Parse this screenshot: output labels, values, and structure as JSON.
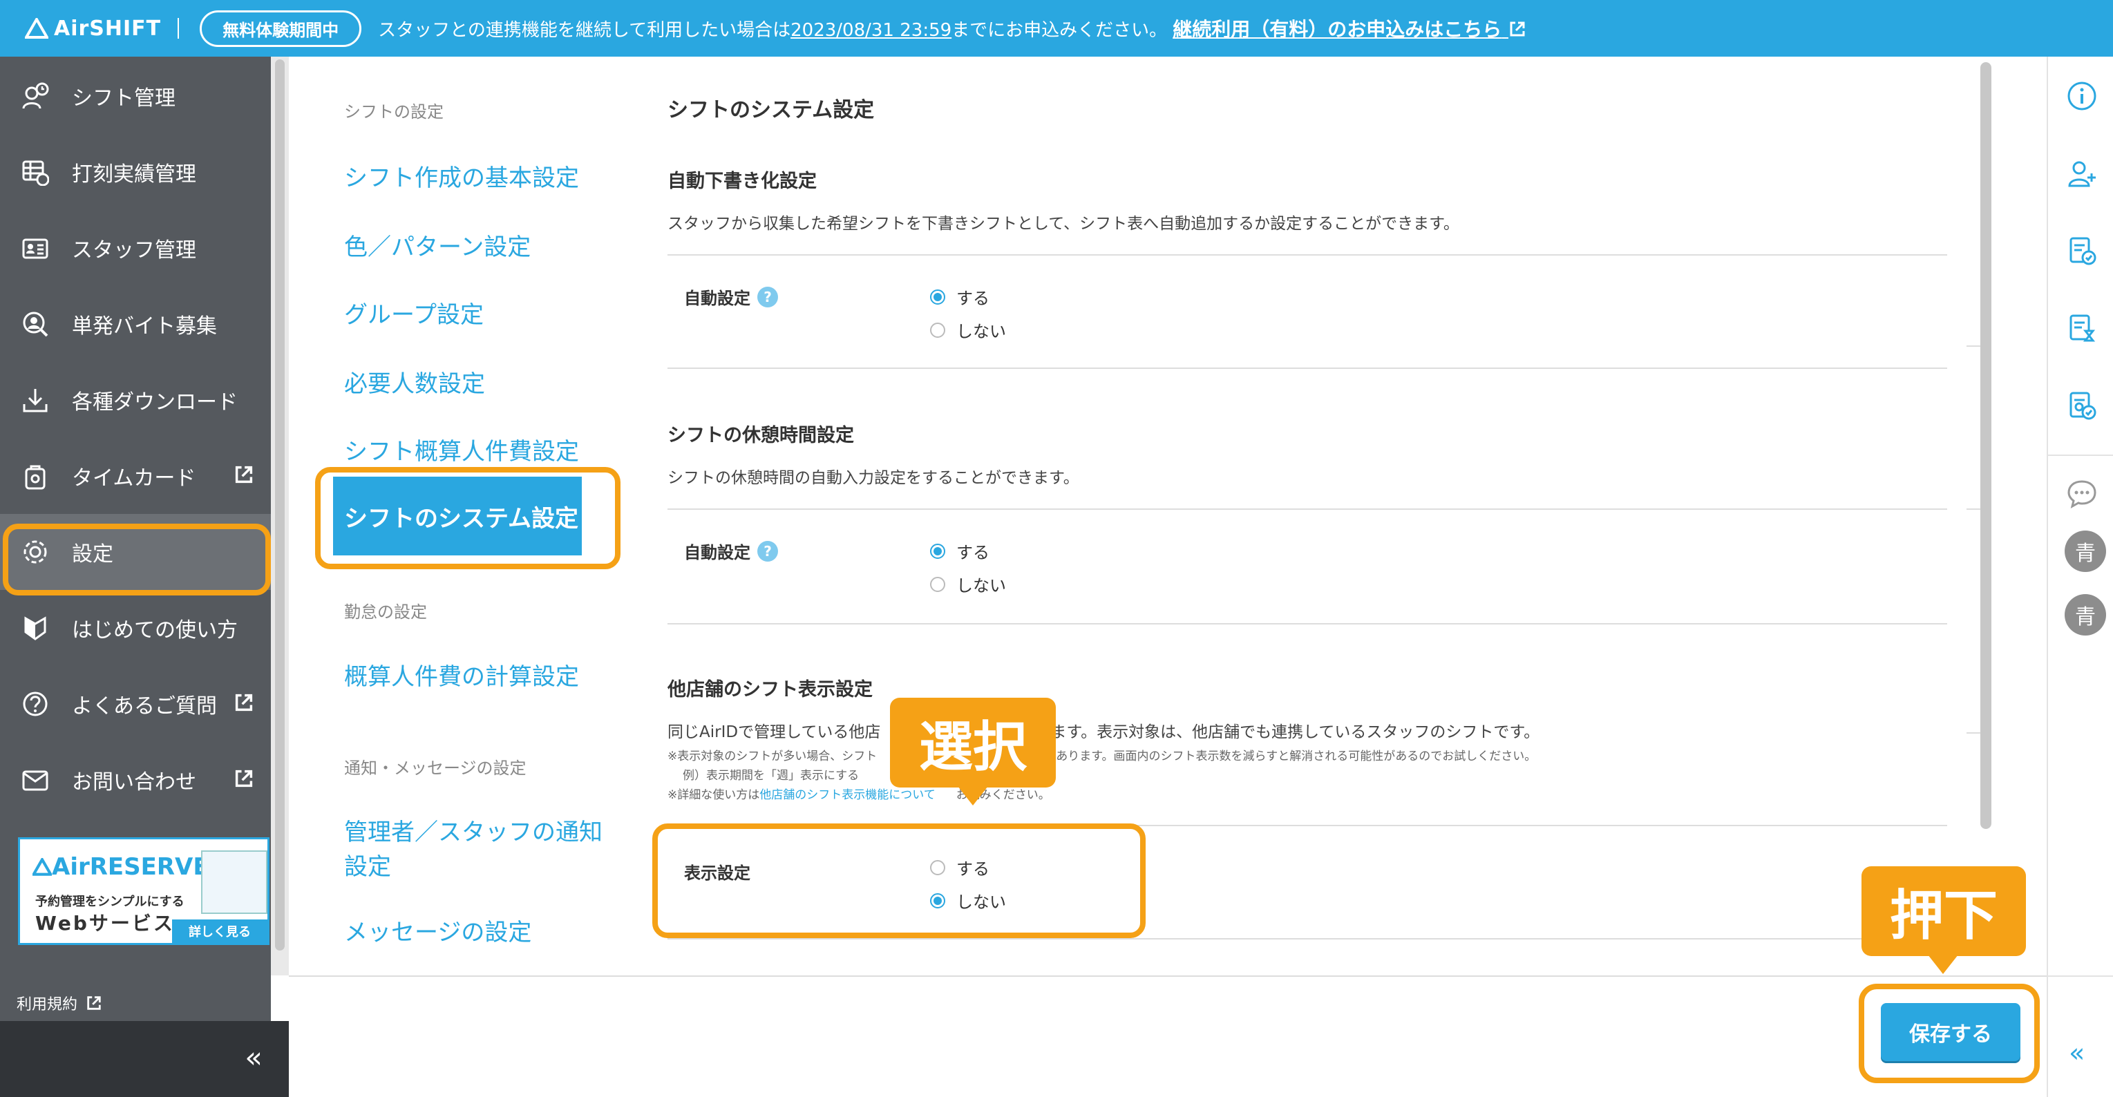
{
  "colors": {
    "accent": "#2aa7e0",
    "sidebar": "#55595e",
    "highlight": "#f5a116"
  },
  "banner": {
    "logo": "AirSHIFT",
    "trial_label": "無料体験期間中",
    "text_before": "スタッフとの連携機能を継続して利用したい場合は",
    "deadline": "2023/08/31 23:59",
    "text_after": "までにお申込みください。",
    "link": "継続利用（有料）のお申込みはこちら"
  },
  "sidebar": {
    "items": [
      {
        "label": "シフト管理",
        "icon": "shift-person-icon"
      },
      {
        "label": "打刻実績管理",
        "icon": "timecard-table-icon"
      },
      {
        "label": "スタッフ管理",
        "icon": "staff-card-icon"
      },
      {
        "label": "単発バイト募集",
        "icon": "search-person-icon"
      },
      {
        "label": "各種ダウンロード",
        "icon": "download-icon"
      },
      {
        "label": "タイムカード",
        "icon": "timecard-icon"
      },
      {
        "label": "設定",
        "icon": "gear-icon"
      },
      {
        "label": "はじめての使い方",
        "icon": "beginner-icon"
      },
      {
        "label": "よくあるご質問",
        "icon": "question-icon"
      },
      {
        "label": "お問い合わせ",
        "icon": "mail-icon"
      }
    ],
    "ad": {
      "logo": "AirRESERVE",
      "sub": "予約管理をシンプルにする",
      "main": "Webサービス",
      "button": "詳しく見る"
    },
    "terms": "利用規約",
    "collapse": "«"
  },
  "subnav": {
    "groups": [
      {
        "title": "シフトの設定",
        "links": [
          "シフト作成の基本設定",
          "色／パターン設定",
          "グループ設定",
          "必要人数設定",
          "シフト概算人件費設定",
          "シフトのシステム設定"
        ]
      },
      {
        "title": "勤怠の設定",
        "links": [
          "概算人件費の計算設定"
        ]
      },
      {
        "title": "通知・メッセージの設定",
        "links": [
          "管理者／スタッフの通知設定",
          "メッセージの設定"
        ]
      }
    ]
  },
  "main": {
    "title": "シフトのシステム設定",
    "sections": [
      {
        "title": "自動下書き化設定",
        "desc": "スタッフから収集した希望シフトを下書きシフトとして、シフト表へ自動追加するか設定することができます。",
        "field": "自動設定",
        "options": [
          "する",
          "しない"
        ]
      },
      {
        "title": "シフトの休憩時間設定",
        "desc": "シフトの休憩時間の自動入力設定をすることができます。",
        "field": "自動設定",
        "options": [
          "する",
          "しない"
        ]
      },
      {
        "title": "他店舗のシフト表示設定",
        "desc_a": "同じAirIDで管理している他店",
        "desc_b": "ます。表示対象は、他店舗でも連携しているスタッフのシフトです。",
        "note1_a": "※表示対象のシフトが多い場合、シフト",
        "note1_b": "があります。画面内のシフト表示数を減らすと解消される可能性があるのでお試しください。",
        "note2": "例）表示期間を「週」表示にする",
        "note3_a": "※詳細な使い方は",
        "note3_link": "他店舗のシフト表示機能について",
        "note3_b": "お読みください。",
        "field": "表示設定",
        "options": [
          "する",
          "しない"
        ]
      }
    ],
    "save": "保存する"
  },
  "callouts": {
    "select": "選択",
    "press": "押下"
  },
  "rail": {
    "icons": [
      "info-icon",
      "add-user-icon",
      "document-check-icon",
      "document-hourglass-icon",
      "document-settings-icon",
      "chat-icon"
    ],
    "avatars": [
      "青",
      "青"
    ],
    "collapse": "«"
  }
}
